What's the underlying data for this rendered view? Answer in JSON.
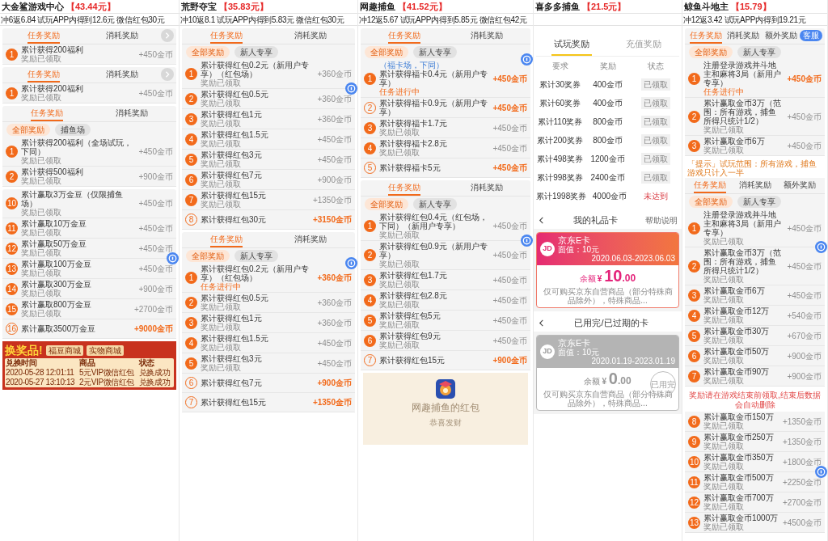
{
  "columns": [
    {
      "title": "大金鲨游戏中心",
      "amount": "【43.44元】",
      "info": "冲6返6.84 试玩APP内得到12.6元 微信红包30元",
      "panels": [
        {
          "kind": "tasks",
          "tabs": [
            {
              "label": "任务奖励",
              "selected": true
            },
            {
              "label": "消耗奖励",
              "selected": false
            }
          ],
          "next_button": true,
          "rows": [
            {
              "num": "1",
              "title": "累计获得200福利",
              "status": "奖励已领取",
              "reward": "+450金币",
              "kind": "claimed"
            }
          ]
        },
        {
          "kind": "tasks",
          "tabs": [
            {
              "label": "任务奖励",
              "selected": true
            },
            {
              "label": "消耗奖励",
              "selected": false
            }
          ],
          "next_button": true,
          "rows": [
            {
              "num": "1",
              "title": "累计获得200福利",
              "status": "奖励已领取",
              "reward": "+450金币",
              "kind": "claimed"
            }
          ]
        },
        {
          "kind": "tasks",
          "tabs": [
            {
              "label": "任务奖励",
              "selected": true
            },
            {
              "label": "消耗奖励",
              "selected": false
            }
          ],
          "chips": [
            {
              "label": "全部奖励",
              "selected": true
            },
            {
              "label": "捕鱼场",
              "selected": false
            }
          ],
          "rows": [
            {
              "num": "1",
              "title": "累计获得200福利（全场试玩，下同）",
              "status": "奖励已领取",
              "reward": "+450金币",
              "kind": "claimed"
            },
            {
              "num": "2",
              "title": "累计获得500福利",
              "status": "奖励已领取",
              "reward": "+900金币",
              "kind": "claimed"
            }
          ]
        },
        {
          "kind": "tasks",
          "rows": [
            {
              "num": "10",
              "title": "累计赢取3万金豆（仅限捕鱼场）",
              "status": "奖励已领取",
              "reward": "+450金币",
              "kind": "claimed"
            },
            {
              "num": "11",
              "title": "累计赢取10万金豆",
              "status": "奖励已领取",
              "reward": "+450金币",
              "kind": "claimed"
            },
            {
              "num": "12",
              "title": "累计赢取50万金豆",
              "status": "奖励已领取",
              "reward": "+450金币",
              "kind": "claimed"
            },
            {
              "num": "13",
              "title": "累计赢取100万金豆",
              "status": "奖励已领取",
              "reward": "+450金币",
              "kind": "claimed",
              "help_icon": true
            },
            {
              "num": "14",
              "title": "累计赢取300万金豆",
              "status": "奖励已领取",
              "reward": "+900金币",
              "kind": "claimed"
            },
            {
              "num": "15",
              "title": "累计赢取800万金豆",
              "status": "奖励已领取",
              "reward": "+2700金币",
              "kind": "claimed"
            },
            {
              "num": "16",
              "title": "累计赢取3500万金豆",
              "reward": "+9000金币",
              "kind": "locked"
            }
          ]
        },
        {
          "kind": "shop",
          "title": "换奖品!",
          "buttons": [
            "福豆商城",
            "实物商城"
          ],
          "headers": [
            "兑换时间",
            "商品",
            "状态"
          ],
          "rows": [
            [
              "2020-05-28 12:01:11",
              "5元VIP微信红包",
              "兑换成功"
            ],
            [
              "2020-05-27 13:10:13",
              "2元VIP微信红包",
              "兑换成功"
            ]
          ]
        }
      ]
    },
    {
      "title": "荒野夺宝",
      "amount": "【35.83元】",
      "info": "冲10返8.1 试玩APP内得到5.83元 微信红包30元",
      "panels": [
        {
          "kind": "tasks",
          "tabs": [
            {
              "label": "任务奖励",
              "selected": true
            },
            {
              "label": "消耗奖励",
              "selected": false
            }
          ],
          "chips": [
            {
              "label": "全部奖励",
              "selected": true
            },
            {
              "label": "新人专享",
              "selected": false
            }
          ],
          "rows": [
            {
              "num": "1",
              "title": "累计获得红包0.2元（新用户专享）（红包场）",
              "status": "奖励已领取",
              "reward": "+360金币",
              "kind": "claimed"
            },
            {
              "num": "2",
              "title": "累计获得红包0.5元",
              "status": "奖励已领取",
              "reward": "+360金币",
              "kind": "claimed",
              "help_icon": true
            },
            {
              "num": "3",
              "title": "累计获得红包1元",
              "status": "奖励已领取",
              "reward": "+360金币",
              "kind": "claimed"
            },
            {
              "num": "4",
              "title": "累计获得红包1.5元",
              "status": "奖励已领取",
              "reward": "+450金币",
              "kind": "claimed"
            },
            {
              "num": "5",
              "title": "累计获得红包3元",
              "status": "奖励已领取",
              "reward": "+450金币",
              "kind": "claimed"
            },
            {
              "num": "6",
              "title": "累计获得红包7元",
              "status": "奖励已领取",
              "reward": "+900金币",
              "kind": "claimed"
            },
            {
              "num": "7",
              "title": "累计获得红包15元",
              "status": "奖励已领取",
              "reward": "+1350金币",
              "kind": "claimed"
            },
            {
              "num": "8",
              "title": "累计获得红包30元",
              "reward": "+3150金币",
              "kind": "locked"
            }
          ]
        },
        {
          "kind": "tasks",
          "tabs": [
            {
              "label": "任务奖励",
              "selected": true
            },
            {
              "label": "消耗奖励",
              "selected": false
            }
          ],
          "chips": [
            {
              "label": "全部奖励",
              "selected": true
            },
            {
              "label": "新人专享",
              "selected": false
            }
          ],
          "rows": [
            {
              "num": "1",
              "title": "累计获得红包0.2元（新用户专享）（红包场）",
              "status": "任务进行中",
              "reward": "+360金币",
              "kind": "active",
              "help_icon": true
            },
            {
              "num": "2",
              "title": "累计获得红包0.5元",
              "status": "奖励已领取",
              "reward": "+360金币",
              "kind": "claimed"
            },
            {
              "num": "3",
              "title": "累计获得红包1元",
              "status": "奖励已领取",
              "reward": "+360金币",
              "kind": "claimed"
            },
            {
              "num": "4",
              "title": "累计获得红包1.5元",
              "status": "奖励已领取",
              "reward": "+450金币",
              "kind": "claimed"
            },
            {
              "num": "5",
              "title": "累计获得红包3元",
              "status": "奖励已领取",
              "reward": "+450金币",
              "kind": "claimed"
            },
            {
              "num": "6",
              "title": "累计获得红包7元",
              "reward": "+900金币",
              "kind": "locked"
            },
            {
              "num": "7",
              "title": "累计获得红包15元",
              "reward": "+1350金币",
              "kind": "locked"
            }
          ]
        }
      ]
    },
    {
      "title": "网趣捕鱼",
      "amount": "【41.52元】",
      "info": "冲12返5.67 试玩APP内得到5.85元 微信红包42元",
      "panels": [
        {
          "kind": "tasks",
          "tabs": [
            {
              "label": "任务奖励",
              "selected": true
            },
            {
              "label": "消耗奖励",
              "selected": false
            }
          ],
          "chips": [
            {
              "label": "全部奖励",
              "selected": true
            },
            {
              "label": "新人专享",
              "selected": false
            }
          ],
          "rows": [
            {
              "num": "1",
              "note": "（福卡场，下同）",
              "title": "累计获得福卡0.4元（新用户专享）",
              "status": "任务进行中",
              "reward": "+450金币",
              "kind": "active",
              "help_icon": true
            },
            {
              "num": "2",
              "title": "累计获得福卡0.9元（新用户专享）",
              "reward": "+450金币",
              "kind": "locked"
            },
            {
              "num": "3",
              "title": "累计获得福卡1.7元",
              "status": "奖励已领取",
              "reward": "+450金币",
              "kind": "claimed"
            },
            {
              "num": "4",
              "title": "累计获得福卡2.8元",
              "status": "奖励已领取",
              "reward": "+450金币",
              "kind": "claimed"
            },
            {
              "num": "5",
              "title": "累计获得福卡5元",
              "reward": "+450金币",
              "kind": "locked"
            }
          ]
        },
        {
          "kind": "tasks",
          "tabs": [
            {
              "label": "任务奖励",
              "selected": true
            },
            {
              "label": "消耗奖励",
              "selected": false
            }
          ],
          "chips": [
            {
              "label": "全部奖励",
              "selected": true
            },
            {
              "label": "新人专享",
              "selected": false
            }
          ],
          "rows": [
            {
              "num": "1",
              "title": "累计获得红包0.4元（红包场，下同）（新用户专享）",
              "status": "奖励已领取",
              "reward": "+450金币",
              "kind": "claimed"
            },
            {
              "num": "2",
              "title": "累计获得红包0.9元（新用户专享）",
              "status": "奖励已领取",
              "reward": "+450金币",
              "kind": "claimed",
              "help_icon": true
            },
            {
              "num": "3",
              "title": "累计获得红包1.7元",
              "status": "奖励已领取",
              "reward": "+450金币",
              "kind": "claimed"
            },
            {
              "num": "4",
              "title": "累计获得红包2.8元",
              "status": "奖励已领取",
              "reward": "+450金币",
              "kind": "claimed"
            },
            {
              "num": "5",
              "title": "累计获得红包5元",
              "status": "奖励已领取",
              "reward": "+450金币",
              "kind": "claimed"
            },
            {
              "num": "6",
              "title": "累计获得红包9元",
              "status": "奖励已领取",
              "reward": "+450金币",
              "kind": "claimed"
            },
            {
              "num": "7",
              "title": "累计获得红包15元",
              "reward": "+900金币",
              "kind": "locked"
            }
          ]
        },
        {
          "kind": "redpacket",
          "title": "网趣捕鱼的红包",
          "subtitle": "恭喜发财"
        }
      ]
    },
    {
      "title": "喜多多捕鱼",
      "amount": "【21.5元】",
      "panels": [
        {
          "kind": "table",
          "tabs": [
            {
              "label": "试玩奖励",
              "selected": true
            },
            {
              "label": "充值奖励",
              "selected": false
            }
          ],
          "headers": [
            "要求",
            "奖励",
            "状态"
          ],
          "rows": [
            {
              "cells": [
                "累计30奖券",
                "400金币"
              ],
              "status": "已领取",
              "kind": "claimed"
            },
            {
              "cells": [
                "累计60奖券",
                "400金币"
              ],
              "status": "已领取",
              "kind": "claimed"
            },
            {
              "cells": [
                "累计110奖券",
                "800金币"
              ],
              "status": "已领取",
              "kind": "claimed"
            },
            {
              "cells": [
                "累计200奖券",
                "800金币"
              ],
              "status": "已领取",
              "kind": "claimed"
            },
            {
              "cells": [
                "累计498奖券",
                "1200金币"
              ],
              "status": "已领取",
              "kind": "claimed"
            },
            {
              "cells": [
                "累计998奖券",
                "2400金币"
              ],
              "status": "已领取",
              "kind": "claimed"
            },
            {
              "cells": [
                "累计1998奖券",
                "4000金币"
              ],
              "status": "未达到",
              "kind": "unreached"
            }
          ]
        },
        {
          "kind": "cards",
          "title": "我的礼品卡",
          "help": "帮助说明",
          "cards": [
            {
              "logo": "JD",
              "name": "京东E卡",
              "face": "面值：10元",
              "dates": "2020.06.03-2023.06.03",
              "balance_label": "余额",
              "currency": "¥",
              "balance": "10",
              "decimals": ".00",
              "note": "仅可购买京东自营商品（部分特殊商品除外），特殊商品...",
              "expired": false
            }
          ]
        },
        {
          "kind": "cards",
          "title": "已用完/已过期的卡",
          "cards": [
            {
              "logo": "JD",
              "name": "京东E卡",
              "face": "面值：10元",
              "dates": "2020.01.19-2023.01.19",
              "balance_label": "余额",
              "currency": "¥",
              "balance": "0",
              "decimals": ".00",
              "note": "仅可购买京东自营商品（部分特殊商品除外），特殊商品...",
              "expired": true,
              "stamp": "已用完"
            }
          ]
        }
      ]
    },
    {
      "title": "鲸鱼斗地主",
      "amount": "【15.79】",
      "info": "冲12返3.42 试玩APP内得到19.21元",
      "panels": [
        {
          "kind": "tasks",
          "tabs": [
            {
              "label": "任务奖励",
              "selected": true
            },
            {
              "label": "消耗奖励",
              "selected": false
            },
            {
              "label": "额外奖励",
              "selected": false
            }
          ],
          "badge": "客服",
          "chips": [
            {
              "label": "全部奖励",
              "selected": true
            },
            {
              "label": "新人专享",
              "selected": false
            }
          ],
          "rows": [
            {
              "num": "1",
              "title": "注册登录游戏并斗地主和麻将3局（新用户专享）",
              "status": "任务进行中",
              "reward": "+450金币",
              "kind": "active"
            },
            {
              "num": "2",
              "title": "累计赢取金币3万（范围：所有游戏，捕鱼所得只统计1/2）",
              "status": "奖励已领取",
              "reward": "+450金币",
              "kind": "claimed"
            },
            {
              "num": "3",
              "title": "累计赢取金币6万",
              "status": "奖励已领取",
              "reward": "+450金币",
              "kind": "claimed"
            }
          ]
        },
        {
          "kind": "tasks",
          "tip": "「提示」试玩范围：所有游戏，捕鱼游戏只计入一半",
          "tabs": [
            {
              "label": "任务奖励",
              "selected": true
            },
            {
              "label": "消耗奖励",
              "selected": false
            },
            {
              "label": "额外奖励",
              "selected": false
            }
          ],
          "chips": [
            {
              "label": "全部奖励",
              "selected": true
            },
            {
              "label": "新人专享",
              "selected": false
            }
          ],
          "rows": [
            {
              "num": "1",
              "title": "注册登录游戏并斗地主和麻将3局（新用户专享）",
              "status": "奖励已领取",
              "reward": "+450金币",
              "kind": "claimed"
            },
            {
              "num": "2",
              "title": "累计赢取金币3万（范围：所有游戏，捕鱼所得只统计1/2）",
              "status": "奖励已领取",
              "reward": "+450金币",
              "kind": "claimed",
              "help_icon": true
            },
            {
              "num": "3",
              "title": "累计赢取金币6万",
              "status": "奖励已领取",
              "reward": "+450金币",
              "kind": "claimed"
            },
            {
              "num": "4",
              "title": "累计赢取金币12万",
              "status": "奖励已领取",
              "reward": "+540金币",
              "kind": "claimed"
            },
            {
              "num": "5",
              "title": "累计赢取金币30万",
              "status": "奖励已领取",
              "reward": "+670金币",
              "kind": "claimed"
            },
            {
              "num": "6",
              "title": "累计赢取金币50万",
              "status": "奖励已领取",
              "reward": "+900金币",
              "kind": "claimed"
            },
            {
              "num": "7",
              "title": "累计赢取金币90万",
              "status": "奖励已领取",
              "reward": "+900金币",
              "kind": "claimed"
            }
          ]
        },
        {
          "kind": "tasks",
          "warning": "奖励请在游戏结束前领取,结束后数据会自动删除",
          "rows": [
            {
              "num": "8",
              "title": "累计赢取金币150万",
              "status": "奖励已领取",
              "reward": "+1350金币",
              "kind": "claimed"
            },
            {
              "num": "9",
              "title": "累计赢取金币250万",
              "status": "奖励已领取",
              "reward": "+1350金币",
              "kind": "claimed"
            },
            {
              "num": "10",
              "title": "累计赢取金币350万",
              "status": "奖励已领取",
              "reward": "+1800金币",
              "kind": "claimed"
            },
            {
              "num": "11",
              "title": "累计赢取金币500万",
              "status": "奖励已领取",
              "reward": "+2250金币",
              "kind": "claimed",
              "help_icon": true
            },
            {
              "num": "12",
              "title": "累计赢取金币700万",
              "status": "奖励已领取",
              "reward": "+2700金币",
              "kind": "claimed"
            },
            {
              "num": "13",
              "title": "累计赢取金币1000万",
              "status": "奖励已领取",
              "reward": "+4500金币",
              "kind": "claimed"
            }
          ]
        }
      ]
    }
  ]
}
